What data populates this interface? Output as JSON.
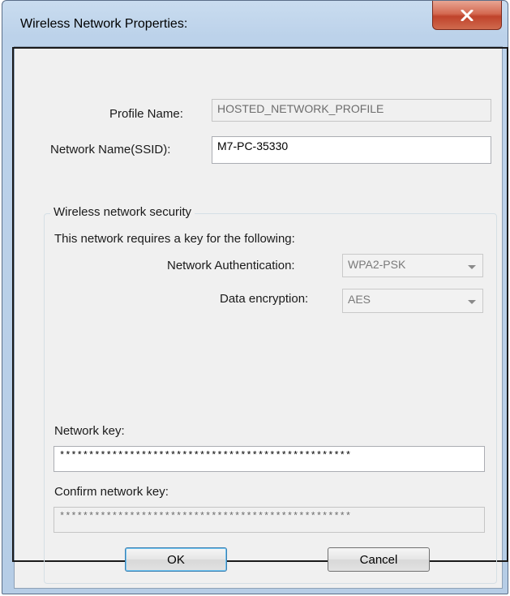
{
  "window": {
    "title": "Wireless Network Properties:"
  },
  "fields": {
    "profile_name_label": "Profile Name:",
    "profile_name_value": "HOSTED_NETWORK_PROFILE",
    "ssid_label": "Network Name(SSID):",
    "ssid_value": "M7-PC-35330"
  },
  "security": {
    "group_label": "Wireless network security",
    "requires_text": "This network requires a key for the following:",
    "auth_label": "Network Authentication:",
    "auth_value": "WPA2-PSK",
    "encryption_label": "Data encryption:",
    "encryption_value": "AES",
    "network_key_label": "Network key:",
    "network_key_value": "**************************************************",
    "confirm_key_label": "Confirm network key:",
    "confirm_key_value": "**************************************************"
  },
  "buttons": {
    "ok": "OK",
    "cancel": "Cancel"
  }
}
